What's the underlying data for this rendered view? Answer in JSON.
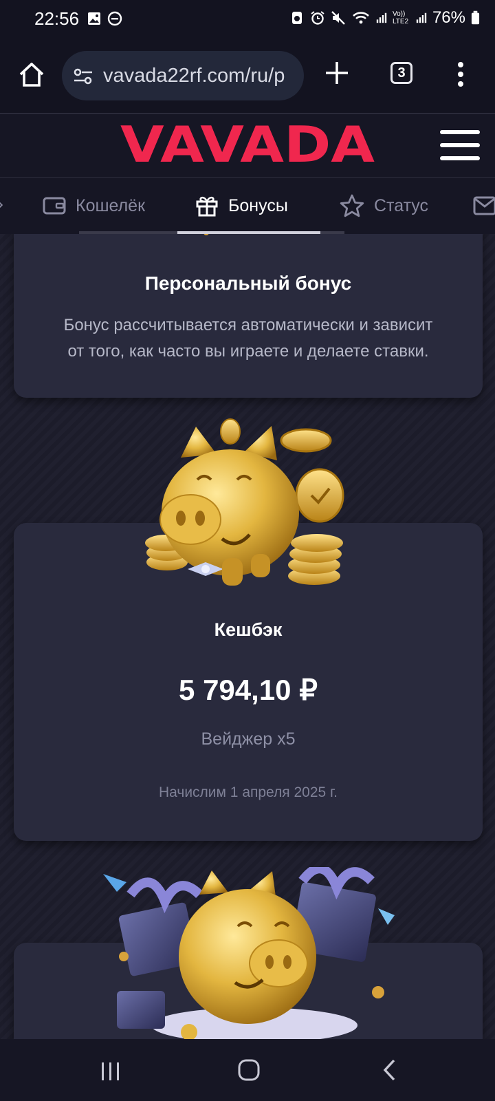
{
  "status_bar": {
    "time": "22:56",
    "network": "Vo)) LTE2",
    "battery": "76%"
  },
  "browser": {
    "url": "vavada22rf.com/ru/p",
    "tab_count": "3"
  },
  "site": {
    "logo_text": "VAVADA",
    "brand_color": "#f0274e",
    "tabs": [
      {
        "label": "Кошелёк",
        "icon": "wallet-icon",
        "active": false
      },
      {
        "label": "Бонусы",
        "icon": "gift-icon",
        "active": true
      },
      {
        "label": "Статус",
        "icon": "star-icon",
        "active": false
      }
    ]
  },
  "cards": {
    "personal": {
      "title": "Персональный бонус",
      "description_line1": "Бонус рассчитывается автоматически и зависит",
      "description_line2": "от того, как часто вы играете и делаете ставки."
    },
    "cashback": {
      "title": "Кешбэк",
      "amount": "5 794,10 ₽",
      "wager": "Вейджер x5",
      "accrual": "Начислим 1 апреля 2025 г."
    }
  }
}
